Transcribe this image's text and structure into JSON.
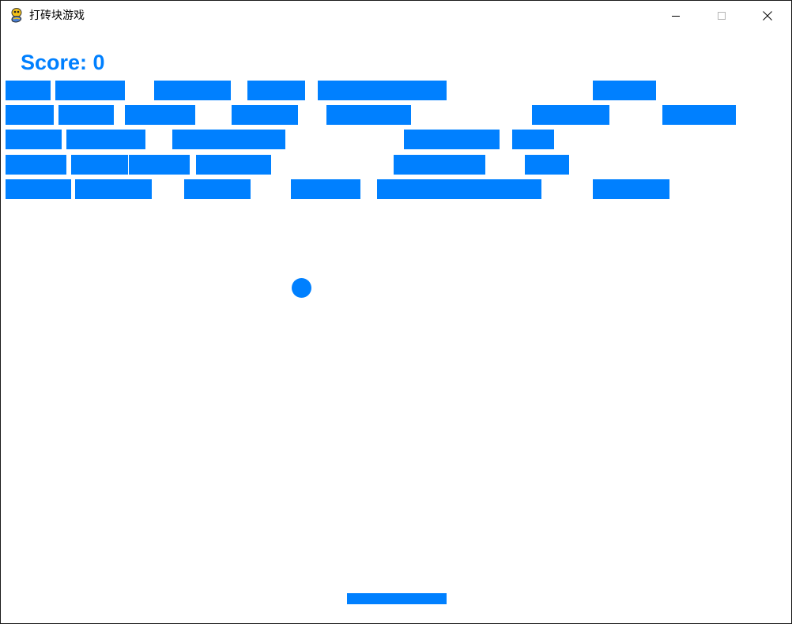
{
  "window": {
    "title": "打砖块游戏",
    "icon": "pygame-snake-icon",
    "controls": {
      "minimize": "minimize-icon",
      "maximize": "maximize-icon",
      "close": "close-icon"
    }
  },
  "game": {
    "score_text": "Score: 0",
    "score": 0,
    "colors": {
      "brick": "#0080ff",
      "ball": "#0080ff",
      "paddle": "#0080ff",
      "score": "#0080ff",
      "background": "#ffffff"
    },
    "brick_rows": 5
  }
}
